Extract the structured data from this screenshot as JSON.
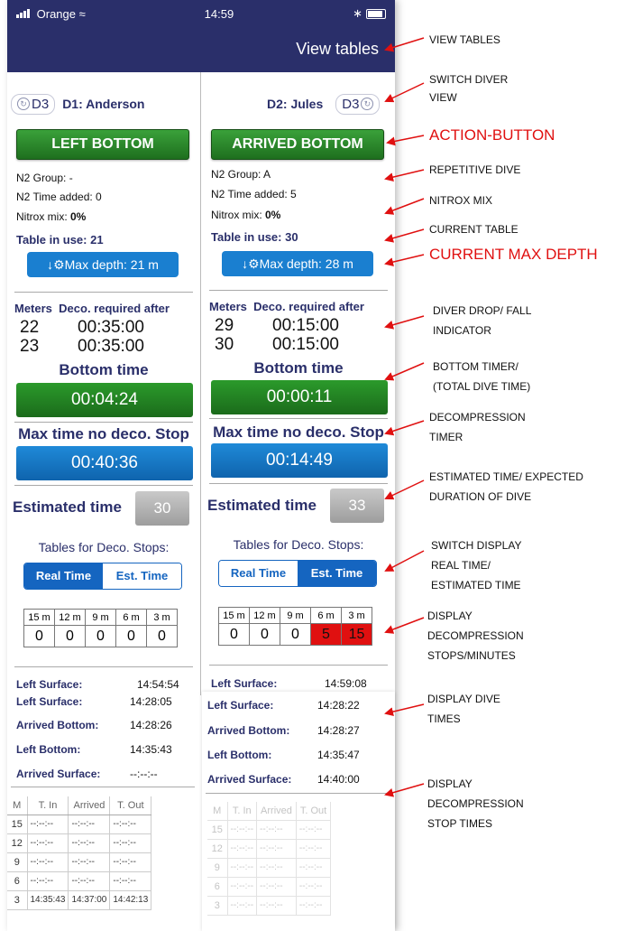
{
  "status": {
    "carrier": "Orange",
    "time": "14:59"
  },
  "header": {
    "view_tables": "View tables"
  },
  "left": {
    "d3_label": "D3",
    "diver_name": "D1: Anderson",
    "action_label": "LEFT BOTTOM",
    "n2_group": "N2 Group:  -",
    "n2_time": "N2 Time added: 0",
    "nitrox_label": "Nitrox mix: ",
    "nitrox_value": "0%",
    "table_in_use": "Table in use: 21",
    "max_depth": "Max depth: 21 m",
    "deco_header_meters": "Meters",
    "deco_header_required": "Deco. required after",
    "deco_rows": [
      {
        "m": "22",
        "t": "00:35:00"
      },
      {
        "m": "23",
        "t": "00:35:00"
      }
    ],
    "bottom_time_label": "Bottom time",
    "bottom_time": "00:04:24",
    "max_nodeco_label": "Max time no deco. Stop",
    "max_nodeco": "00:40:36",
    "est_label": "Estimated time",
    "est_value": "30",
    "tables_label": "Tables for Deco. Stops:",
    "seg_real": "Real Time",
    "seg_est": "Est. Time",
    "stop_headers": [
      "15 m",
      "12 m",
      "9 m",
      "6 m",
      "3 m"
    ],
    "stop_values": [
      "0",
      "0",
      "0",
      "0",
      "0"
    ],
    "left_surface_top": {
      "label": "Left Surface:",
      "value": "14:54:54"
    }
  },
  "right": {
    "d3_label": "D3",
    "diver_name": "D2: Jules",
    "action_label": "ARRIVED BOTTOM",
    "n2_group": "N2 Group:  A",
    "n2_time": "N2 Time added: 5",
    "nitrox_label": "Nitrox mix: ",
    "nitrox_value": "0%",
    "table_in_use": "Table in use: 30",
    "max_depth": "Max depth: 28 m",
    "deco_header_meters": "Meters",
    "deco_header_required": "Deco. required after",
    "deco_rows": [
      {
        "m": "29",
        "t": "00:15:00"
      },
      {
        "m": "30",
        "t": "00:15:00"
      }
    ],
    "bottom_time_label": "Bottom time",
    "bottom_time": "00:00:11",
    "max_nodeco_label": "Max time no deco. Stop",
    "max_nodeco": "00:14:49",
    "est_label": "Estimated time",
    "est_value": "33",
    "tables_label": "Tables for Deco. Stops:",
    "seg_real": "Real Time",
    "seg_est": "Est. Time",
    "stop_headers": [
      "15 m",
      "12 m",
      "9 m",
      "6 m",
      "3 m"
    ],
    "stop_values": [
      "0",
      "0",
      "0",
      "5",
      "15"
    ],
    "left_surface_top": {
      "label": "Left Surface:",
      "value": "14:59:08"
    }
  },
  "left_times": [
    {
      "label": "Left Surface:",
      "value": "14:28:05"
    },
    {
      "label": "Arrived Bottom:",
      "value": "14:28:26"
    },
    {
      "label": "Left Bottom:",
      "value": "14:35:43"
    },
    {
      "label": "Arrived Surface:",
      "value": "--:--:--"
    }
  ],
  "right_times": [
    {
      "label": "Left Surface:",
      "value": "14:28:22"
    },
    {
      "label": "Arrived Bottom:",
      "value": "14:28:27"
    },
    {
      "label": "Left Bottom:",
      "value": "14:35:47"
    },
    {
      "label": "Arrived Surface:",
      "value": "14:40:00"
    }
  ],
  "stop_table_headers": [
    "M",
    "T. In",
    "Arrived",
    "T. Out"
  ],
  "left_stop_rows": [
    [
      "15",
      "--:--:--",
      "--:--:--",
      "--:--:--"
    ],
    [
      "12",
      "--:--:--",
      "--:--:--",
      "--:--:--"
    ],
    [
      "9",
      "--:--:--",
      "--:--:--",
      "--:--:--"
    ],
    [
      "6",
      "--:--:--",
      "--:--:--",
      "--:--:--"
    ],
    [
      "3",
      "14:35:43",
      "14:37:00",
      "14:42:13"
    ]
  ],
  "right_stop_rows": [
    [
      "15",
      "--:--:--",
      "--:--:--",
      "--:--:--"
    ],
    [
      "12",
      "--:--:--",
      "--:--:--",
      "--:--:--"
    ],
    [
      "9",
      "--:--:--",
      "--:--:--",
      "--:--:--"
    ],
    [
      "6",
      "--:--:--",
      "--:--:--",
      "--:--:--"
    ],
    [
      "3",
      "--:--:--",
      "--:--:--",
      "--:--:--"
    ]
  ],
  "annotations": {
    "view_tables": "VIEW TABLES",
    "switch_view_1": "SWITCH DIVER",
    "switch_view_2": "VIEW",
    "action_button": "ACTION-BUTTON",
    "repetitive": "REPETITIVE DIVE",
    "nitrox": "NITROX MIX",
    "current_table": "CURRENT TABLE",
    "current_max": "CURRENT MAX DEPTH",
    "drop_1": "DIVER DROP/ FALL",
    "drop_2": "INDICATOR",
    "bottom_1": "BOTTOM TIMER/",
    "bottom_2": "(TOTAL DIVE TIME)",
    "deco_1": "DECOMPRESSION",
    "deco_2": "TIMER",
    "est_1": "ESTIMATED TIME/ EXPECTED",
    "est_2": "DURATION OF DIVE",
    "switch_1": "SWITCH DISPLAY",
    "switch_2": "REAL TIME/",
    "switch_3": "ESTIMATED TIME",
    "disp_1": "DISPLAY",
    "disp_2": "DECOMPRESSION",
    "disp_3": "STOPS/MINUTES",
    "dive_1": "DISPLAY DIVE",
    "dive_2": "TIMES",
    "stop_1": "DISPLAY",
    "stop_2": "DECOMPRESSION",
    "stop_3": "STOP TIMES"
  },
  "colors": {
    "navy": "#2a2f6a",
    "green": "#1e6f1e",
    "blue": "#1a7fd0",
    "red": "#e01010"
  }
}
